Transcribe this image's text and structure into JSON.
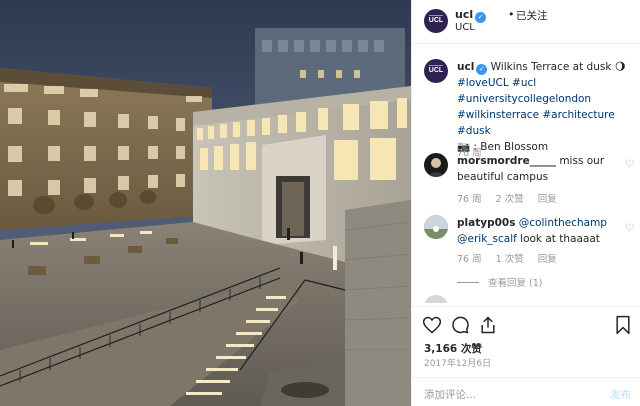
{
  "header": {
    "username": "ucl",
    "dot": "•",
    "follow_status": "已关注",
    "location": "UCL",
    "avatar_text": "UCL"
  },
  "caption": {
    "username": "ucl",
    "text_main": "Wilkins Terrace at dusk",
    "moon_icon": "🌖",
    "hashtags_line1": "#loveUCL #ucl",
    "hashtags_line2": "#universitycollegelondon",
    "hashtags_line3": "#wilkinsterrace #architecture #dusk",
    "credit": "📷 : Ben Blossom",
    "age": "76 周"
  },
  "comments": [
    {
      "username": "morsmordre_____",
      "text": " miss our beautiful campus",
      "age": "76 周",
      "likes": "2 次赞",
      "reply": "回复"
    },
    {
      "username": "platyp00s",
      "mention1": "@colinthechamp",
      "mention2": "@erik_scalf",
      "text": " look at thaaaat",
      "age": "76 周",
      "likes": "1 次赞",
      "reply": "回复",
      "view_replies": "查看回复 (1)"
    }
  ],
  "stats": {
    "likes": "3,166 次赞",
    "date": "2017年12月6日"
  },
  "comment_box": {
    "placeholder": "添加评论...",
    "post_label": "发布"
  },
  "icons": {
    "verified": "verified-badge-icon",
    "heart": "heart-icon",
    "comment": "comment-icon",
    "share": "share-icon",
    "save": "bookmark-icon"
  },
  "colors": {
    "verified_blue": "#3897f0",
    "hashtag_blue": "#003569",
    "muted_gray": "#999999",
    "post_button": "#b2dffc"
  }
}
